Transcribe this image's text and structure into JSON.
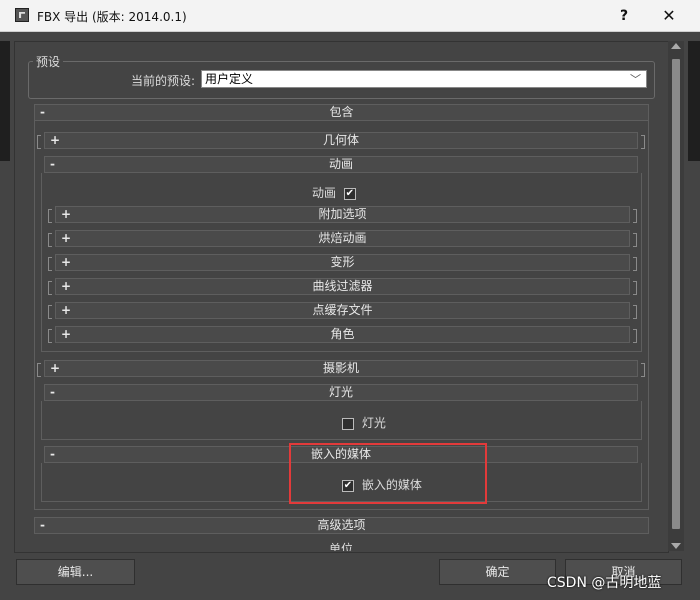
{
  "window": {
    "title": "FBX 导出 (版本: 2014.0.1)",
    "help_label": "?",
    "close_label": "✕"
  },
  "presets": {
    "group_label": "预设",
    "current_label": "当前的预设:",
    "current_value": "用户定义"
  },
  "rollouts": {
    "include": {
      "sign": "-",
      "label": "包含"
    },
    "geometry": {
      "sign": "+",
      "label": "几何体"
    },
    "animation": {
      "sign": "-",
      "label": "动画"
    },
    "animation_check_label": "动画",
    "extra_options": {
      "sign": "+",
      "label": "附加选项"
    },
    "bake_animation": {
      "sign": "+",
      "label": "烘焙动画"
    },
    "deformation": {
      "sign": "+",
      "label": "变形"
    },
    "curve_filters": {
      "sign": "+",
      "label": "曲线过滤器"
    },
    "point_cache": {
      "sign": "+",
      "label": "点缓存文件"
    },
    "character": {
      "sign": "+",
      "label": "角色"
    },
    "cameras": {
      "sign": "+",
      "label": "摄影机"
    },
    "lights": {
      "sign": "-",
      "label": "灯光"
    },
    "lights_check_label": "灯光",
    "embed_media": {
      "sign": "-",
      "label": "嵌入的媒体"
    },
    "embed_media_check_label": "嵌入的媒体",
    "advanced": {
      "sign": "-",
      "label": "高级选项"
    },
    "units_partial": "单位"
  },
  "checks": {
    "animation": true,
    "lights": false,
    "embed_media": true
  },
  "buttons": {
    "edit": "编辑...",
    "ok": "确定",
    "cancel": "取消"
  },
  "watermark": "CSDN @古明地蓝"
}
